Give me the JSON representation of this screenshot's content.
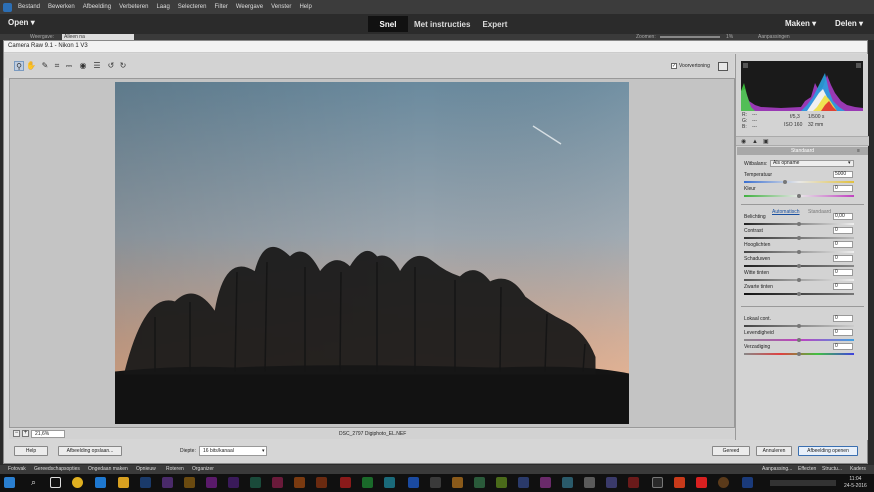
{
  "menubar": {
    "items": [
      "Bestand",
      "Bewerken",
      "Afbeelding",
      "Verbeteren",
      "Laag",
      "Selecteren",
      "Filter",
      "Weergave",
      "Venster",
      "Help"
    ]
  },
  "modebar": {
    "open_label": "Open",
    "modes": [
      "Snel",
      "Met instructies",
      "Expert"
    ],
    "active_mode": "Snel",
    "maken_label": "Maken",
    "delen_label": "Delen"
  },
  "strip": {
    "view_label": "Weergave:",
    "view_value": "Alleen na",
    "zoom_label": "Zoomen:",
    "zoom_value": "1%",
    "panel_label": "Aanpassingen"
  },
  "dialog": {
    "title": "Camera Raw 9.1 - Nikon 1 V3",
    "preview_label": "Voorvertoning",
    "zoom_value": "21,6%",
    "filename": "DSC_2797 Digiphoto_EL.NEF",
    "help_label": "Help",
    "save_label": "Afbeelding opslaan...",
    "depth_label": "Diepte:",
    "depth_value": "16 bits/kanaal",
    "done_label": "Gereed",
    "cancel_label": "Annuleren",
    "open_label": "Afbeelding openen"
  },
  "panel": {
    "r_label": "R:",
    "g_label": "G:",
    "b_label": "B:",
    "rgb_value": "---",
    "aperture": "f/5,3",
    "shutter": "1/500 s",
    "iso": "ISO 160",
    "focal": "32 mm",
    "header": "Standaard",
    "wb_label": "Witbalans:",
    "wb_value": "Als opname",
    "auto_label": "Automatisch",
    "default_label": "Standaard",
    "sliders": [
      {
        "label": "Temperatuur",
        "value": "5000",
        "fraction": 0.37
      },
      {
        "label": "Kleur",
        "value": "0",
        "fraction": 0.5
      },
      {
        "label": "Belichting",
        "value": "0,00",
        "fraction": 0.5
      },
      {
        "label": "Contrast",
        "value": "0",
        "fraction": 0.5
      },
      {
        "label": "Hooglichten",
        "value": "0",
        "fraction": 0.5
      },
      {
        "label": "Schaduwen",
        "value": "0",
        "fraction": 0.5
      },
      {
        "label": "Witte tinten",
        "value": "0",
        "fraction": 0.5
      },
      {
        "label": "Zwarte tinten",
        "value": "0",
        "fraction": 0.5
      },
      {
        "label": "Lokaal cont.",
        "value": "0",
        "fraction": 0.5
      },
      {
        "label": "Levendigheid",
        "value": "0",
        "fraction": 0.5
      },
      {
        "label": "Verzadiging",
        "value": "0",
        "fraction": 0.5
      }
    ]
  },
  "appstrip": {
    "left_items": [
      "Fotovak",
      "Gereedschapsopties",
      "Ongedaan maken",
      "Opnieuw",
      "Roteren",
      "Organizer"
    ],
    "right_items": [
      "Aanpassing...",
      "Effecten",
      "Structu...",
      "Kaders"
    ]
  },
  "taskbar": {
    "time": "11:04",
    "date": "24-5-2016"
  },
  "colors": {
    "accent": "#3a6fb0",
    "sky_top": "#6f8fa2",
    "sky_bottom": "#f0b08a"
  }
}
